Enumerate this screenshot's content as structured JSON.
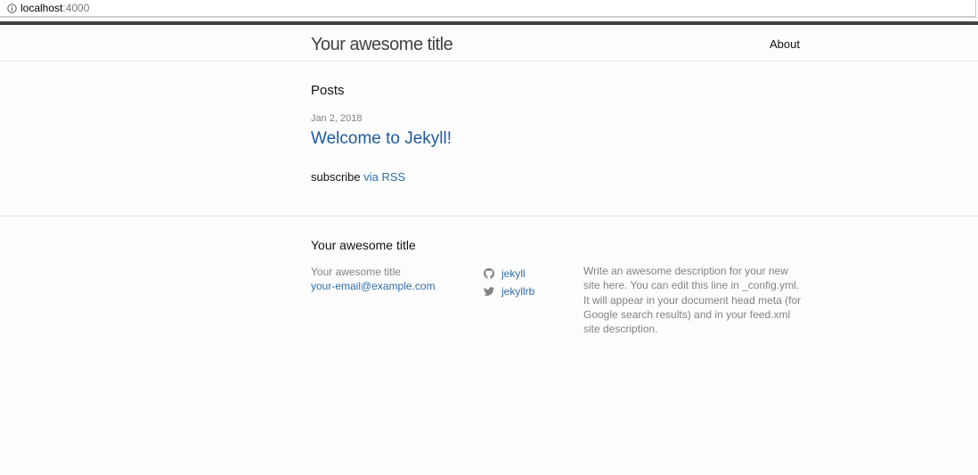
{
  "browser": {
    "url_host": "localhost",
    "url_port": ":4000"
  },
  "header": {
    "site_title": "Your awesome title",
    "nav_about": "About"
  },
  "main": {
    "posts_heading": "Posts",
    "posts": [
      {
        "date": "Jan 2, 2018",
        "title": "Welcome to Jekyll!"
      }
    ],
    "subscribe_text": "subscribe",
    "subscribe_link": "via RSS"
  },
  "footer": {
    "heading": "Your awesome title",
    "site_name": "Your awesome title",
    "email": "your-email@example.com",
    "github_username": "jekyll",
    "twitter_username": "jekyllrb",
    "description": "Write an awesome description for your new site here. You can edit this line in _config.yml. It will appear in your document head meta (for Google search results) and in your feed.xml site description."
  },
  "colors": {
    "link": "#2e6ea8",
    "post_link": "#1f5a9c",
    "header_border": "#424242",
    "muted_text": "#828282",
    "background": "#fdfdfd"
  },
  "icons": {
    "address_bar": "info-icon",
    "github": "github-icon",
    "twitter": "twitter-icon"
  }
}
